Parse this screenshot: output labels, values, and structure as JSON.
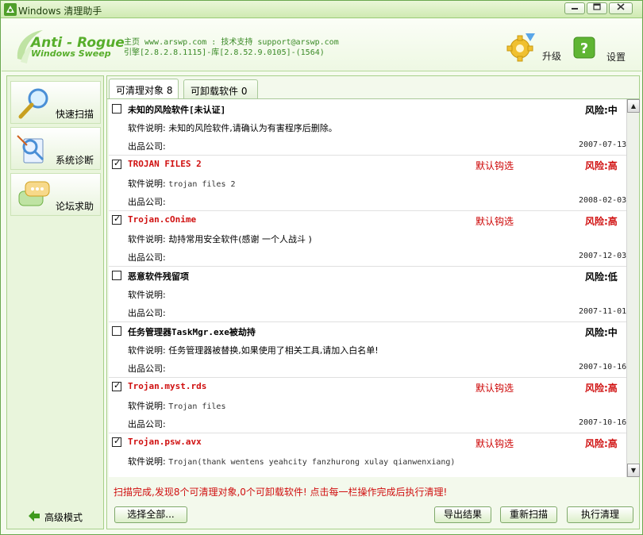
{
  "window": {
    "title": "Windows 清理助手",
    "controls": [
      "minimize",
      "restore",
      "close"
    ]
  },
  "header": {
    "brand_line1": "Anti - Rogue",
    "brand_line2": "Windows Sweep",
    "line1": "主页 www.arswp.com : 技术支持 support@arswp.com",
    "line2": "引擎[2.8.2.8.1115]-库[2.8.52.9.0105]-(1564)",
    "upgrade_label": "升级",
    "settings_label": "设置"
  },
  "sidebar": {
    "items": [
      {
        "label": "快速扫描",
        "icon": "magnifier-icon"
      },
      {
        "label": "系统诊断",
        "icon": "diagnosis-icon"
      },
      {
        "label": "论坛求助",
        "icon": "chat-bubble-icon"
      }
    ],
    "advanced_label": "高级模式"
  },
  "tabs": [
    {
      "label": "可清理对象 8",
      "active": true
    },
    {
      "label": "可卸载软件 0",
      "active": false
    }
  ],
  "list": {
    "desc_prefix": "软件说明:",
    "company_prefix": "出品公司:",
    "items": [
      {
        "checked": false,
        "name": "未知的风险软件[未认证]",
        "red": false,
        "default": "",
        "risk": "风险:中",
        "desc": "未知的风险软件,请确认为有害程序后删除。",
        "date": "2007-07-13"
      },
      {
        "checked": true,
        "name": "TROJAN FILES 2",
        "red": true,
        "default": "默认钩选",
        "risk": "风险:高",
        "desc": "trojan files 2",
        "date": "2008-02-03"
      },
      {
        "checked": true,
        "name": "Trojan.cOnime",
        "red": true,
        "default": "默认钩选",
        "risk": "风险:高",
        "desc": "劫持常用安全软件(感谢 一个人战斗 )",
        "date": "2007-12-03"
      },
      {
        "checked": false,
        "name": "恶意软件残留项",
        "red": false,
        "default": "",
        "risk": "风险:低",
        "desc": "",
        "date": "2007-11-01"
      },
      {
        "checked": false,
        "name": "任务管理器TaskMgr.exe被劫持",
        "red": false,
        "default": "",
        "risk": "风险:中",
        "desc": "任务管理器被替换,如果使用了相关工具,请加入白名单!",
        "date": "2007-10-16"
      },
      {
        "checked": true,
        "name": "Trojan.myst.rds",
        "red": true,
        "default": "默认钩选",
        "risk": "风险:高",
        "desc": "Trojan files",
        "date": "2007-10-16"
      },
      {
        "checked": true,
        "name": "Trojan.psw.avx",
        "red": true,
        "default": "默认钩选",
        "risk": "风险:高",
        "desc": "Trojan(thank wentens yeahcity fanzhurong xulay qianwenxiang)",
        "date": ""
      }
    ]
  },
  "status": "扫描完成,发现8个可清理对象,0个可卸载软件! 点击每一栏操作完成后执行清理!",
  "buttons": {
    "select_all": "选择全部...",
    "export": "导出结果",
    "rescan": "重新扫描",
    "clean": "执行清理"
  },
  "colors": {
    "accent_green": "#57ae2b",
    "risk_red": "#d01010"
  }
}
